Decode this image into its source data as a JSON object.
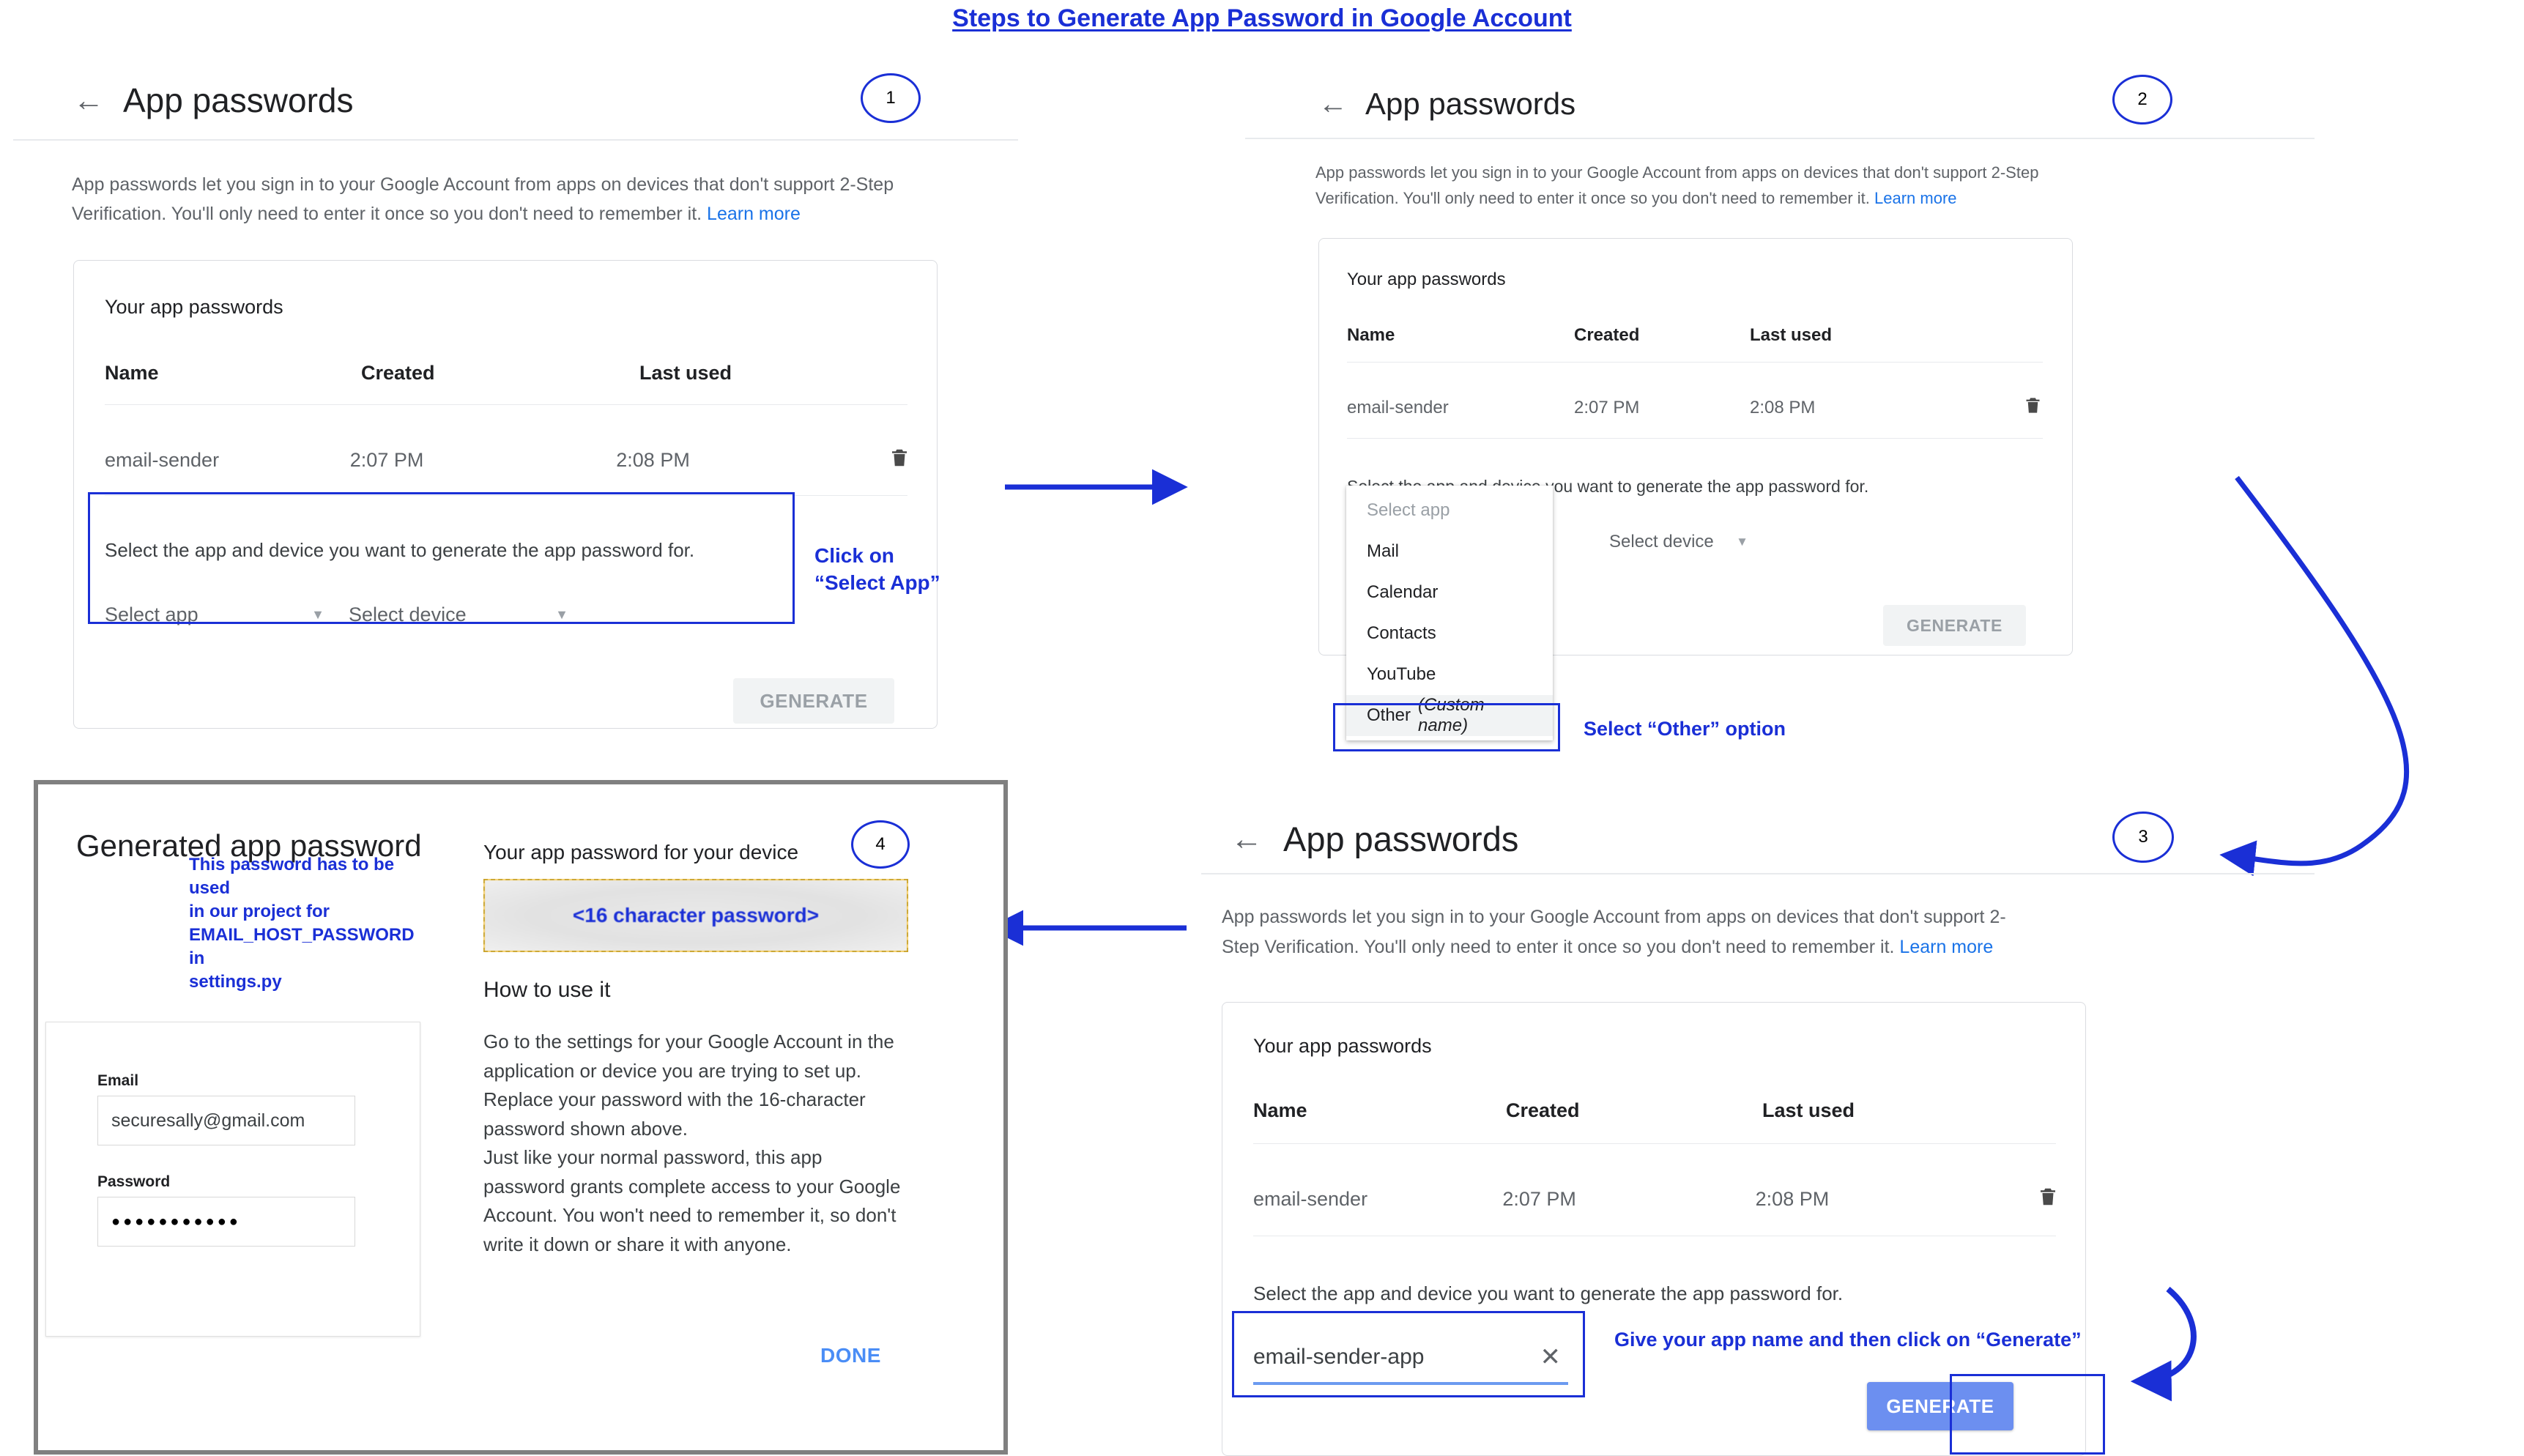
{
  "figure": {
    "title": "Steps to Generate App Password in Google Account",
    "accent_blue": "#1a2fd6",
    "google_blue": "#1a73e8",
    "highlight_yellow": "#f7cf68"
  },
  "common": {
    "back_icon": "back-arrow-icon",
    "page_title": "App passwords",
    "intro_text": "App passwords let you sign in to your Google Account from apps on devices that don't support 2-Step Verification. You'll only need to enter it once so you don't need to remember it.",
    "learn_more": "Learn more",
    "card_heading": "Your app passwords",
    "columns": [
      "Name",
      "Created",
      "Last used"
    ],
    "row": {
      "name": "email-sender",
      "created": "2:07 PM",
      "last_used": "2:08 PM"
    },
    "delete_icon": "trash-icon",
    "select_prompt": "Select the app and device you want to generate the app password for.",
    "select_app_label": "Select app",
    "select_device_label": "Select device",
    "generate_label": "GENERATE"
  },
  "step1": {
    "number": "1",
    "annotation_line1": "Click on",
    "annotation_line2": "“Select App”"
  },
  "step2": {
    "number": "2",
    "dropdown_items": [
      {
        "label": "Select app",
        "muted": true,
        "selected": false,
        "italic_suffix": ""
      },
      {
        "label": "Mail",
        "muted": false,
        "selected": false,
        "italic_suffix": ""
      },
      {
        "label": "Calendar",
        "muted": false,
        "selected": false,
        "italic_suffix": ""
      },
      {
        "label": "Contacts",
        "muted": false,
        "selected": false,
        "italic_suffix": ""
      },
      {
        "label": "YouTube",
        "muted": false,
        "selected": false,
        "italic_suffix": ""
      },
      {
        "label": "Other",
        "muted": false,
        "selected": true,
        "italic_suffix": "(Custom name)"
      }
    ],
    "other_label": "Other",
    "other_italic": "(Custom name)",
    "annotation": "Select “Other” option"
  },
  "step3": {
    "number": "3",
    "app_name_value": "email-sender-app",
    "clear_icon": "close-x-icon",
    "annotation": "Give your app name and then click on “Generate”",
    "generate_label": "GENERATE"
  },
  "step4": {
    "number": "4",
    "dialog_title": "Generated app password",
    "device_label": "Your app password for your device",
    "password_placeholder": "<16 character password>",
    "annotation_lines": [
      "This password has to be used",
      "in our project for",
      "EMAIL_HOST_PASSWORD in",
      "settings.py"
    ],
    "howto_heading": "How to use it",
    "howto_body": "Go to the settings for your Google Account in the application or device you are trying to set up. Replace your password with the 16-character password shown above.\nJust like your normal password, this app password grants complete access to your Google Account. You won't need to remember it, so don't write it down or share it with anyone.",
    "done_label": "DONE",
    "mini_form": {
      "email_label": "Email",
      "email_value": "securesally@gmail.com",
      "password_label": "Password",
      "password_value": "●●●●●●●●●●●"
    }
  }
}
